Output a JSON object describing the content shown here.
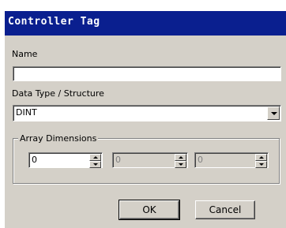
{
  "dialog": {
    "title": "Controller Tag",
    "name_label": "Name",
    "name_value": "",
    "datatype_label": "Data Type / Structure",
    "datatype_value": "DINT",
    "array_group_label": "Array Dimensions",
    "dim1_value": "0",
    "dim2_value": "0",
    "dim3_value": "0",
    "ok_label": "OK",
    "cancel_label": "Cancel"
  },
  "colors": {
    "titlebar": "#0a1f8f",
    "dialog_bg": "#d4d0c8",
    "field_bg": "#ffffff"
  },
  "icons": [
    "chevron-down-icon",
    "spin-up-icon",
    "spin-down-icon"
  ]
}
